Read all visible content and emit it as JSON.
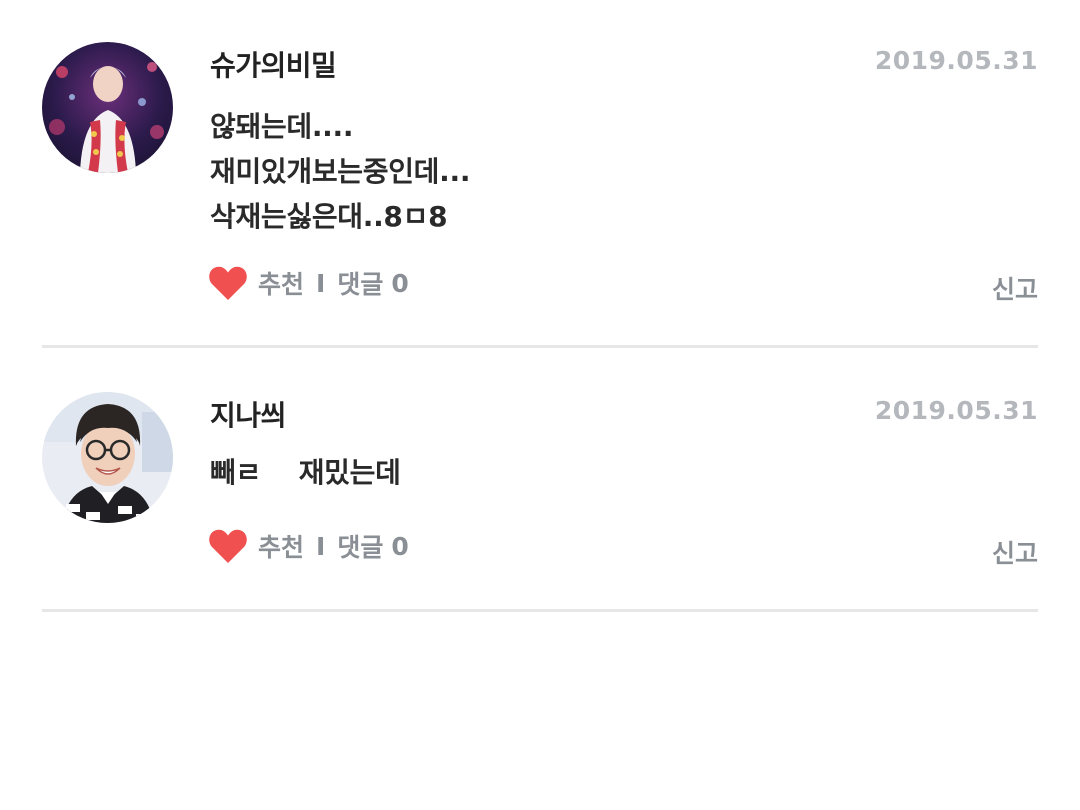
{
  "comments": [
    {
      "author": "슈가의비밀",
      "date": "2019.05.31",
      "body_lines": [
        "않돼는데....",
        "재미있개보는중인데...",
        "삭재는싫은대..8ㅁ8"
      ],
      "like_label": "추천",
      "separator": "I",
      "reply_label": "댓글",
      "reply_count": "0",
      "report_label": "신고",
      "avatar_icon": "user-avatar-photo"
    },
    {
      "author": "지나씌",
      "date": "2019.05.31",
      "body_lines": [
        "빼ㄹ    재밌는데"
      ],
      "like_label": "추천",
      "separator": "I",
      "reply_label": "댓글",
      "reply_count": "0",
      "report_label": "신고",
      "avatar_icon": "user-avatar-photo"
    }
  ],
  "colors": {
    "heart": "#f15050",
    "meta_text": "#8a8f95",
    "date_text": "#b4b8bd",
    "divider": "#e7e7e7"
  },
  "icons": {
    "like": "heart-icon"
  }
}
